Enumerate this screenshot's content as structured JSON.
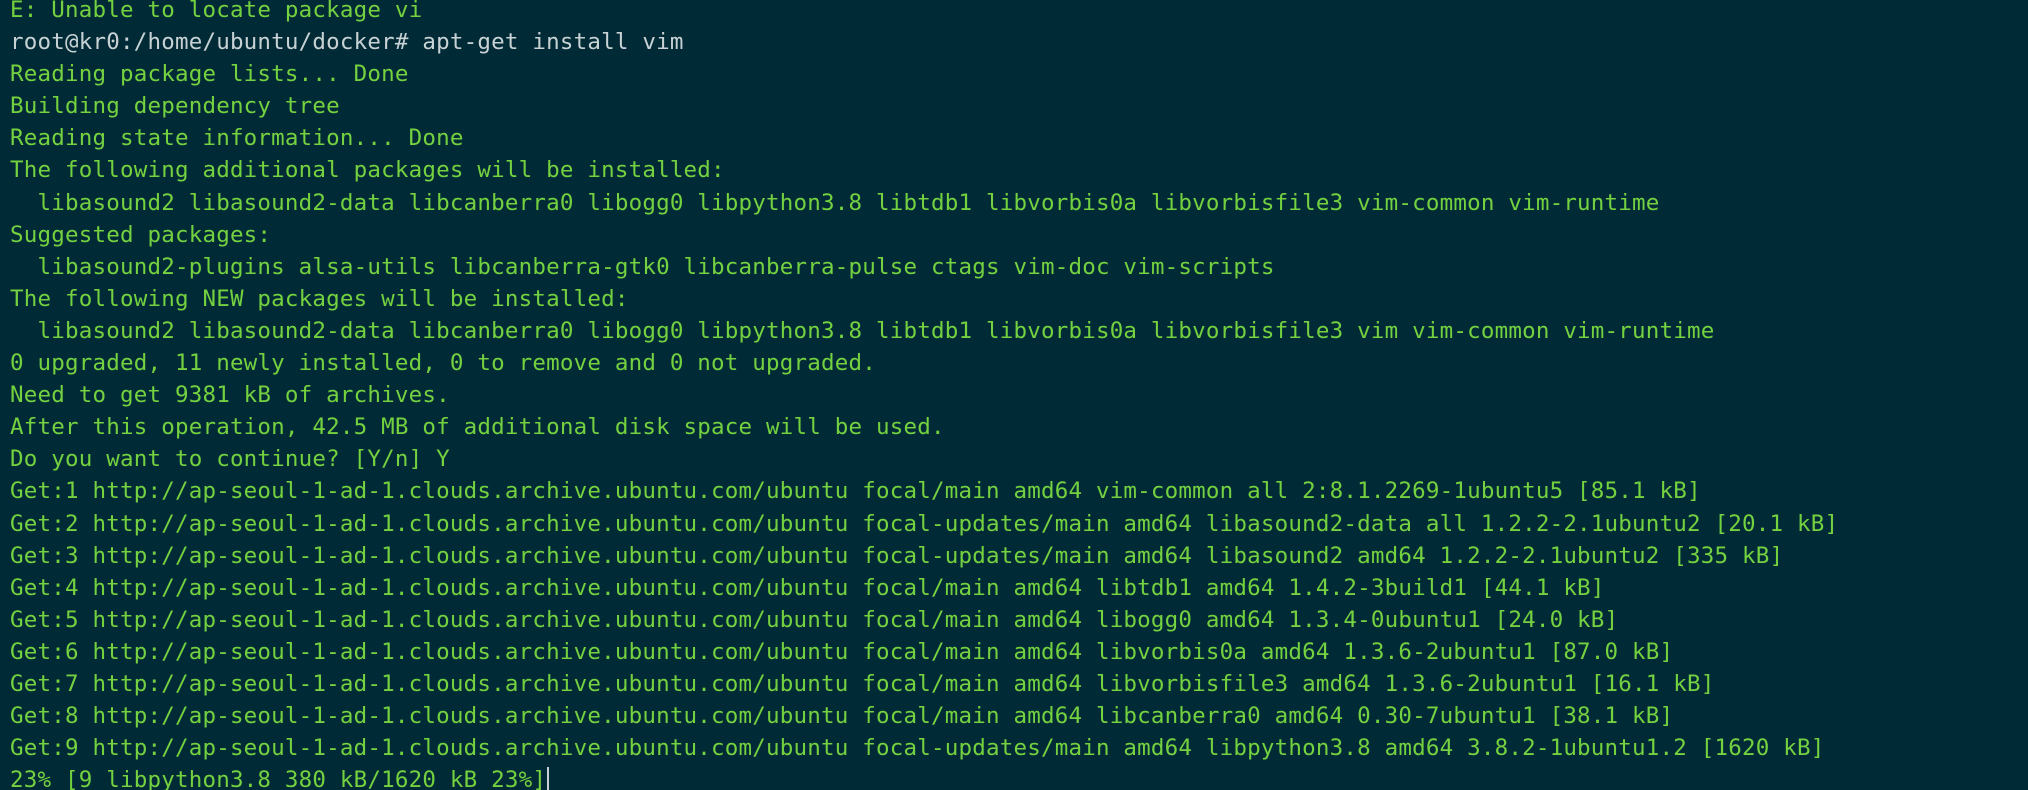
{
  "terminal": {
    "background": "#002b36",
    "output_color": "#74d13f",
    "command_color": "#c8d2d4",
    "lines": [
      {
        "text": "E: Unable to locate package vi",
        "kind": "output"
      },
      {
        "text": "root@kr0:/home/ubuntu/docker# apt-get install vim",
        "kind": "cmd"
      },
      {
        "text": "Reading package lists... Done",
        "kind": "output"
      },
      {
        "text": "Building dependency tree",
        "kind": "output"
      },
      {
        "text": "Reading state information... Done",
        "kind": "output"
      },
      {
        "text": "The following additional packages will be installed:",
        "kind": "output"
      },
      {
        "text": "  libasound2 libasound2-data libcanberra0 libogg0 libpython3.8 libtdb1 libvorbis0a libvorbisfile3 vim-common vim-runtime",
        "kind": "output"
      },
      {
        "text": "Suggested packages:",
        "kind": "output"
      },
      {
        "text": "  libasound2-plugins alsa-utils libcanberra-gtk0 libcanberra-pulse ctags vim-doc vim-scripts",
        "kind": "output"
      },
      {
        "text": "The following NEW packages will be installed:",
        "kind": "output"
      },
      {
        "text": "  libasound2 libasound2-data libcanberra0 libogg0 libpython3.8 libtdb1 libvorbis0a libvorbisfile3 vim vim-common vim-runtime",
        "kind": "output"
      },
      {
        "text": "0 upgraded, 11 newly installed, 0 to remove and 0 not upgraded.",
        "kind": "output"
      },
      {
        "text": "Need to get 9381 kB of archives.",
        "kind": "output"
      },
      {
        "text": "After this operation, 42.5 MB of additional disk space will be used.",
        "kind": "output"
      },
      {
        "text": "Do you want to continue? [Y/n] Y",
        "kind": "output"
      },
      {
        "text": "Get:1 http://ap-seoul-1-ad-1.clouds.archive.ubuntu.com/ubuntu focal/main amd64 vim-common all 2:8.1.2269-1ubuntu5 [85.1 kB]",
        "kind": "output"
      },
      {
        "text": "Get:2 http://ap-seoul-1-ad-1.clouds.archive.ubuntu.com/ubuntu focal-updates/main amd64 libasound2-data all 1.2.2-2.1ubuntu2 [20.1 kB]",
        "kind": "output"
      },
      {
        "text": "Get:3 http://ap-seoul-1-ad-1.clouds.archive.ubuntu.com/ubuntu focal-updates/main amd64 libasound2 amd64 1.2.2-2.1ubuntu2 [335 kB]",
        "kind": "output"
      },
      {
        "text": "Get:4 http://ap-seoul-1-ad-1.clouds.archive.ubuntu.com/ubuntu focal/main amd64 libtdb1 amd64 1.4.2-3build1 [44.1 kB]",
        "kind": "output"
      },
      {
        "text": "Get:5 http://ap-seoul-1-ad-1.clouds.archive.ubuntu.com/ubuntu focal/main amd64 libogg0 amd64 1.3.4-0ubuntu1 [24.0 kB]",
        "kind": "output"
      },
      {
        "text": "Get:6 http://ap-seoul-1-ad-1.clouds.archive.ubuntu.com/ubuntu focal/main amd64 libvorbis0a amd64 1.3.6-2ubuntu1 [87.0 kB]",
        "kind": "output"
      },
      {
        "text": "Get:7 http://ap-seoul-1-ad-1.clouds.archive.ubuntu.com/ubuntu focal/main amd64 libvorbisfile3 amd64 1.3.6-2ubuntu1 [16.1 kB]",
        "kind": "output"
      },
      {
        "text": "Get:8 http://ap-seoul-1-ad-1.clouds.archive.ubuntu.com/ubuntu focal/main amd64 libcanberra0 amd64 0.30-7ubuntu1 [38.1 kB]",
        "kind": "output"
      },
      {
        "text": "Get:9 http://ap-seoul-1-ad-1.clouds.archive.ubuntu.com/ubuntu focal-updates/main amd64 libpython3.8 amd64 3.8.2-1ubuntu1.2 [1620 kB]",
        "kind": "output"
      },
      {
        "text": "23% [9 libpython3.8 380 kB/1620 kB 23%]",
        "kind": "output",
        "cursor": true
      }
    ]
  }
}
